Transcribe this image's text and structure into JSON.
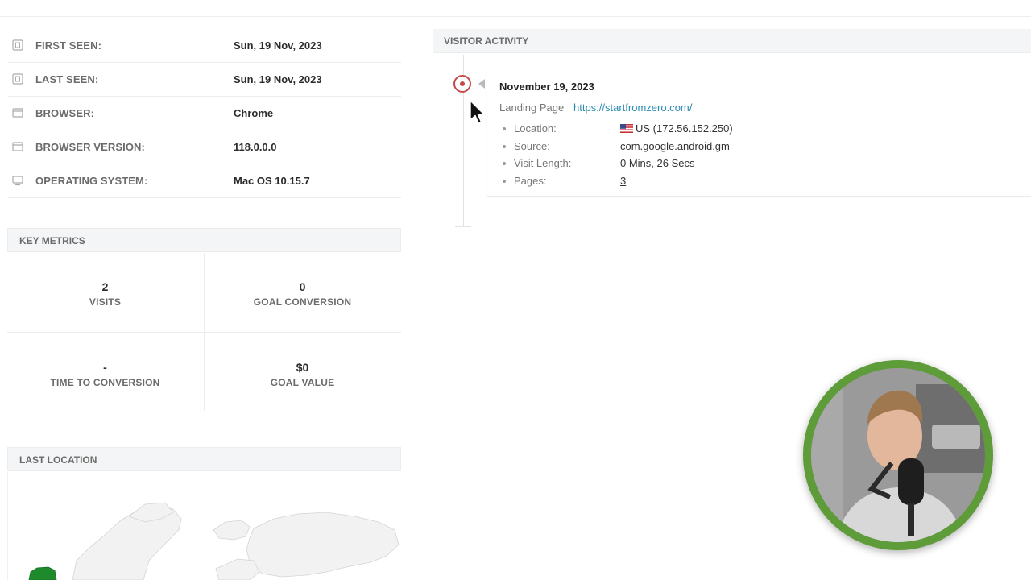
{
  "details": [
    {
      "icon": "calendar-icon",
      "label": "FIRST SEEN:",
      "value": "Sun, 19 Nov, 2023"
    },
    {
      "icon": "calendar-icon",
      "label": "LAST SEEN:",
      "value": "Sun, 19 Nov, 2023"
    },
    {
      "icon": "browser-icon",
      "label": "BROWSER:",
      "value": "Chrome"
    },
    {
      "icon": "browser-icon",
      "label": "BROWSER VERSION:",
      "value": "118.0.0.0"
    },
    {
      "icon": "monitor-icon",
      "label": "OPERATING SYSTEM:",
      "value": "Mac OS 10.15.7"
    }
  ],
  "key_metrics": {
    "title": "KEY METRICS",
    "items": [
      {
        "value": "2",
        "label": "VISITS"
      },
      {
        "value": "0",
        "label": "GOAL CONVERSION"
      },
      {
        "value": "-",
        "label": "TIME TO CONVERSION"
      },
      {
        "value": "$0",
        "label": "GOAL VALUE"
      }
    ]
  },
  "last_location": {
    "title": "LAST LOCATION"
  },
  "visitor_activity": {
    "title": "VISITOR ACTIVITY",
    "entry": {
      "date": "November 19, 2023",
      "landing_label": "Landing Page",
      "landing_url": "https://startfromzero.com/",
      "stats": [
        {
          "key": "Location:",
          "value": "US (172.56.152.250)",
          "flag": "us-flag-icon"
        },
        {
          "key": "Source:",
          "value": "com.google.android.gm"
        },
        {
          "key": "Visit Length:",
          "value": "0 Mins, 26 Secs"
        },
        {
          "key": "Pages:",
          "value": "3",
          "link": true
        }
      ]
    }
  },
  "colors": {
    "accent_link": "#2a8bb3",
    "timeline_dot": "#c44a4a",
    "webcam_ring": "#5e9c3a",
    "map_highlight": "#1e8a2c"
  }
}
